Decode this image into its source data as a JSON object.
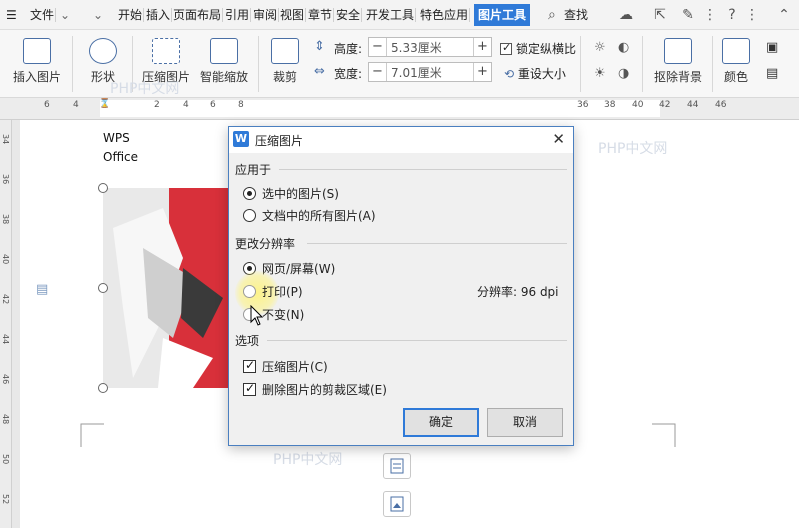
{
  "menubar": {
    "file_label": "文件",
    "tabs": [
      "开始",
      "插入",
      "页面布局",
      "引用",
      "审阅",
      "视图",
      "章节",
      "安全",
      "开发工具",
      "特色应用"
    ],
    "active_tab": "图片工具",
    "search_label": "查找"
  },
  "ribbon": {
    "insert_picture": "插入图片",
    "shape": "形状",
    "compress": "压缩图片",
    "smart_zoom": "智能缩放",
    "crop": "裁剪",
    "height_label": "高度:",
    "height_value": "5.33厘米",
    "width_label": "宽度:",
    "width_value": "7.01厘米",
    "lock_ratio": "锁定纵横比",
    "reset_size": "重设大小",
    "remove_bg": "抠除背景",
    "color": "颜色"
  },
  "ruler": {
    "h_marks": [
      "6",
      "4",
      "2",
      "",
      "2",
      "4",
      "6",
      "8",
      "",
      "36",
      "38",
      "40",
      "42",
      "44",
      "46"
    ],
    "v_marks": [
      "34",
      "36",
      "38",
      "40",
      "42",
      "44",
      "46",
      "48",
      "50",
      "52"
    ]
  },
  "document": {
    "text_line1": "WPS",
    "text_line2": "Office",
    "watermark": "PHP中文网"
  },
  "dialog": {
    "title": "压缩图片",
    "apply_to_label": "应用于",
    "apply_selected": "选中的图片(S)",
    "apply_all": "文档中的所有图片(A)",
    "resolution_label": "更改分辨率",
    "res_web": "网页/屏幕(W)",
    "res_print": "打印(P)",
    "res_none": "不变(N)",
    "resolution_value": "分辨率: 96 dpi",
    "options_label": "选项",
    "opt_compress": "压缩图片(C)",
    "opt_delete_crop": "删除图片的剪裁区域(E)",
    "ok": "确定",
    "cancel": "取消"
  }
}
